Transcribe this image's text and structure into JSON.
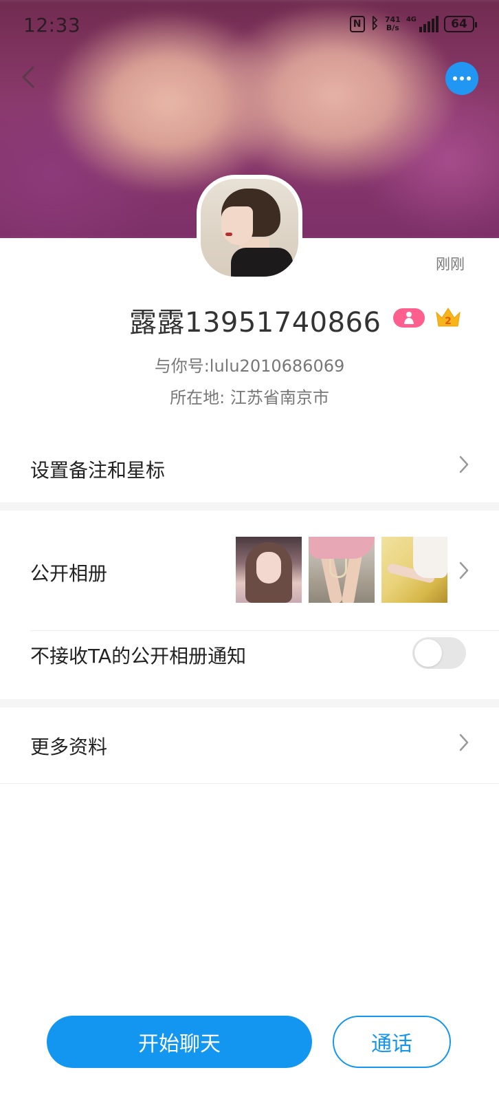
{
  "status_bar": {
    "time": "12:33",
    "net_speed_value": "741",
    "net_speed_unit": "B/s",
    "network": "4G",
    "battery": "64",
    "icons": [
      "nfc-icon",
      "bluetooth-icon",
      "signal-icon",
      "battery-icon"
    ]
  },
  "header": {
    "back_icon": "chevron-left-icon",
    "more_icon": "more-dots-icon",
    "accent_color": "#2196f3"
  },
  "profile": {
    "last_active": "刚刚",
    "name": "露露13951740866",
    "gender_badge_icon": "female-icon",
    "gender_badge_color": "#ff5f8f",
    "level_badge_icon": "crown-icon",
    "level": "2",
    "account_line": "与你号:lulu2010686069",
    "location_line": "所在地: 江苏省南京市"
  },
  "rows": {
    "remark": {
      "label": "设置备注和星标"
    },
    "album": {
      "label": "公开相册",
      "photo_count": 3
    },
    "notify": {
      "label": "不接收TA的公开相册通知",
      "enabled": false
    },
    "more_info": {
      "label": "更多资料"
    }
  },
  "actions": {
    "chat_label": "开始聊天",
    "call_label": "通话",
    "primary_color": "#1296f0"
  }
}
